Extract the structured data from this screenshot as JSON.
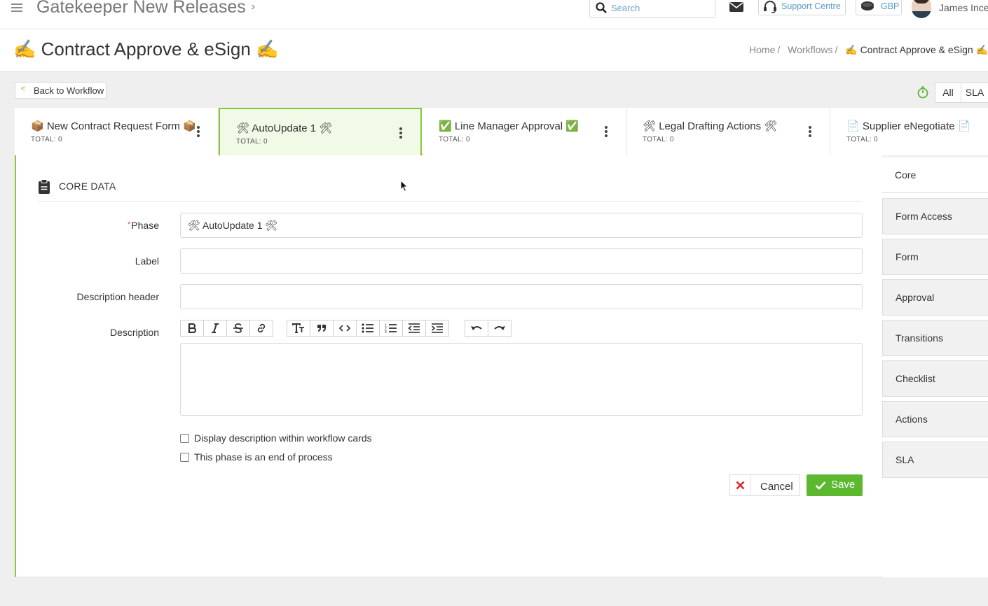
{
  "topbar": {
    "app_title": "Gatekeeper New Releases",
    "search_placeholder": "Search",
    "support_label": "Support Centre",
    "currency_label": "GBP",
    "user_name": "James Ince"
  },
  "header": {
    "page_title": "✍️ Contract Approve & eSign ✍️",
    "breadcrumb": [
      "Home",
      "Workflows",
      "✍️ Contract Approve & eSign ✍️"
    ]
  },
  "toolbar": {
    "back_label": "Back to Workflow",
    "view_all_label": "All",
    "view_sla_label": "SLA"
  },
  "phases": [
    {
      "title": "📦 New Contract Request Form 📦",
      "total": "TOTAL: 0",
      "active": false
    },
    {
      "title": "🛠 AutoUpdate 1 🛠",
      "total": "TOTAL: 0",
      "active": true
    },
    {
      "title": "✅ Line Manager Approval ✅",
      "total": "TOTAL: 0",
      "active": false
    },
    {
      "title": "🛠 Legal Drafting Actions 🛠",
      "total": "TOTAL: 0",
      "active": false
    },
    {
      "title": "📄 Supplier eNegotiate 📄",
      "total": "TOTAL: 0",
      "active": false
    }
  ],
  "form": {
    "section_title": "CORE DATA",
    "phase_label": "Phase",
    "phase_required_mark": "*",
    "phase_value": "🛠 AutoUpdate 1 🛠",
    "label_label": "Label",
    "label_value": "",
    "description_header_label": "Description header",
    "description_header_value": "",
    "description_label": "Description",
    "description_value": "",
    "checkbox_display_label": "Display description within workflow cards",
    "checkbox_display_checked": false,
    "checkbox_end_label": "This phase is an end of process",
    "checkbox_end_checked": false,
    "cancel_label": "Cancel",
    "save_label": "Save"
  },
  "side_nav": {
    "items": [
      "Core",
      "Form Access",
      "Form",
      "Approval",
      "Transitions",
      "Checklist",
      "Actions",
      "SLA"
    ],
    "active": "Core"
  },
  "colors": {
    "accent_green": "#8cc63f",
    "save_green": "#5cb82e",
    "link_blue": "#5a9ac6",
    "cancel_red": "#d9262c"
  }
}
